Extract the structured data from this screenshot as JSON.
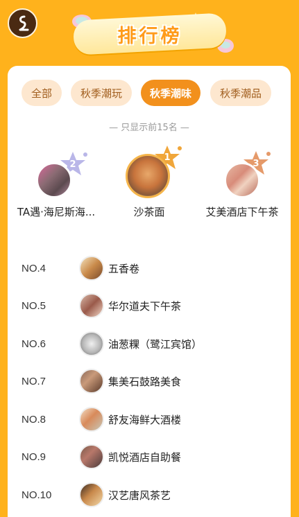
{
  "header": {
    "title": "排行榜",
    "back_icon": "back-icon"
  },
  "tabs": [
    {
      "label": "全部",
      "active": false
    },
    {
      "label": "秋季潮玩",
      "active": false
    },
    {
      "label": "秋季潮味",
      "active": true
    },
    {
      "label": "秋季潮品",
      "active": false
    }
  ],
  "hint": "— 只显示前15名 —",
  "podium": [
    {
      "rank": "2",
      "label": "TA遇·海尼斯海...",
      "badge_color": "#b9b6e8"
    },
    {
      "rank": "1",
      "label": "沙茶面",
      "badge_color": "#f0a63a"
    },
    {
      "rank": "3",
      "label": "艾美酒店下午茶",
      "badge_color": "#e59a6a"
    }
  ],
  "list": [
    {
      "no": "NO.4",
      "name": "五香卷"
    },
    {
      "no": "NO.5",
      "name": "华尔道夫下午茶"
    },
    {
      "no": "NO.6",
      "name": "油葱粿（鹭江宾馆）"
    },
    {
      "no": "NO.7",
      "name": "集美石鼓路美食"
    },
    {
      "no": "NO.8",
      "name": "舒友海鲜大酒楼"
    },
    {
      "no": "NO.9",
      "name": "凯悦酒店自助餐"
    },
    {
      "no": "NO.10",
      "name": "汉艺唐风茶艺"
    }
  ],
  "colors": {
    "background": "#ffb21c",
    "tab_active": "#f2901c",
    "tab_inactive": "#fde7cf"
  }
}
